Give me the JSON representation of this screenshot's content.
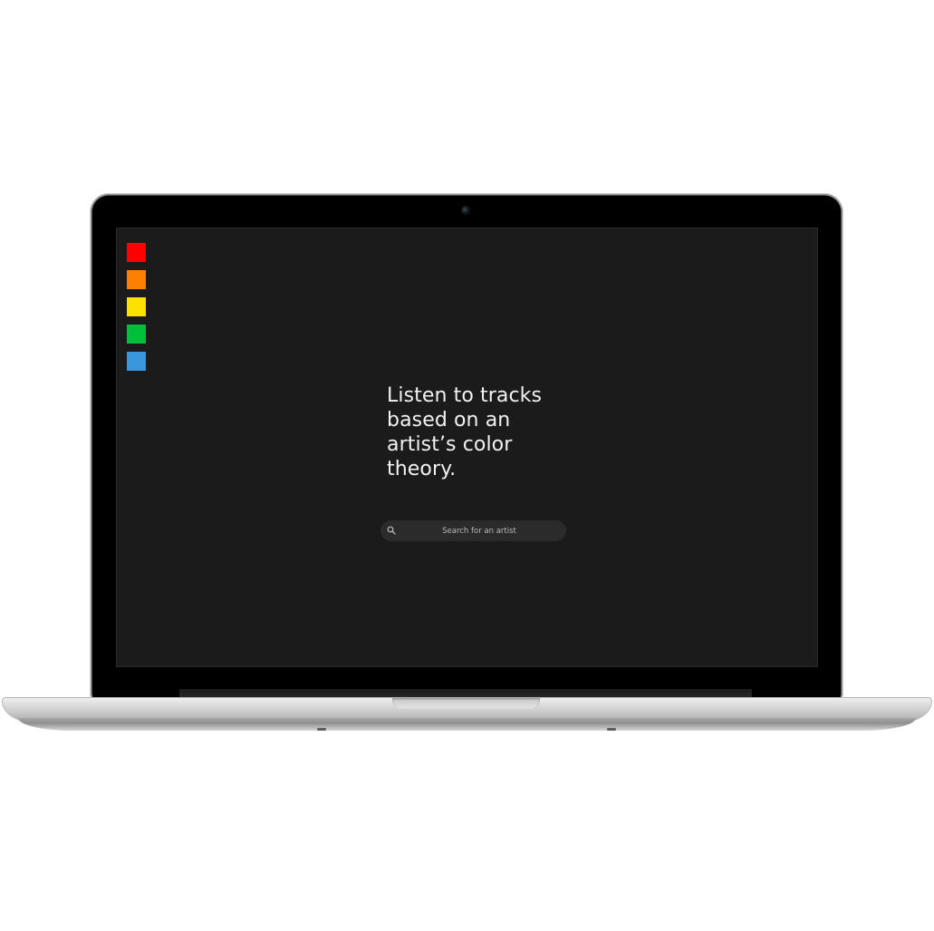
{
  "app": {
    "headline": "Listen to tracks based on an artist’s color theory.",
    "search": {
      "placeholder": "Search for an artist",
      "value": ""
    },
    "swatches": [
      {
        "name": "red",
        "color": "#ff0000"
      },
      {
        "name": "orange",
        "color": "#ff7f00"
      },
      {
        "name": "yellow",
        "color": "#ffe100"
      },
      {
        "name": "green",
        "color": "#00c03b"
      },
      {
        "name": "blue",
        "color": "#3a96dd"
      }
    ],
    "colors": {
      "background": "#1b1b1b",
      "headline": "#f2f2f2",
      "search_bg": "#2b2b2b"
    },
    "icons": {
      "search": "search-icon"
    }
  }
}
